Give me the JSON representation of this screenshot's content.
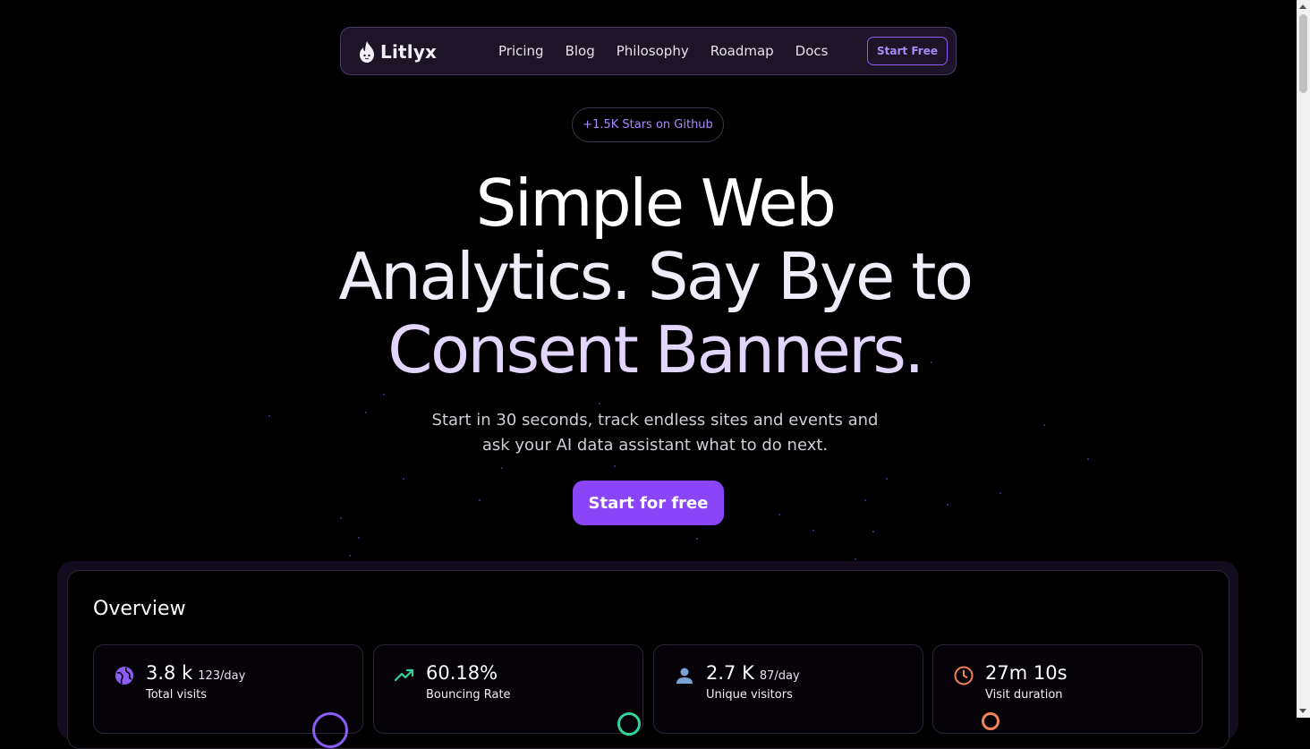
{
  "nav": {
    "brand": "Litlyx",
    "links": [
      "Pricing",
      "Blog",
      "Philosophy",
      "Roadmap",
      "Docs"
    ],
    "cta": "Start Free"
  },
  "badge": "+1.5K Stars on Github",
  "hero": {
    "line1": "Simple Web",
    "line2": "Analytics. Say Bye to",
    "line3": "Consent Banners."
  },
  "subtitle": {
    "line1": "Start in 30 seconds, track endless sites and events and",
    "line2": "ask your AI data assistant what to do next."
  },
  "cta": "Start for free",
  "overview": {
    "title": "Overview",
    "cards": [
      {
        "value": "3.8 k",
        "rate": "123/day",
        "label": "Total visits",
        "icon": "globe-icon",
        "color": "#8b5cf6"
      },
      {
        "value": "60.18%",
        "rate": "",
        "label": "Bouncing Rate",
        "icon": "trending-up-icon",
        "color": "#34d399"
      },
      {
        "value": "2.7 K",
        "rate": "87/day",
        "label": "Unique visitors",
        "icon": "user-icon",
        "color": "#7aa2d6"
      },
      {
        "value": "27m 10s",
        "rate": "",
        "label": "Visit duration",
        "icon": "clock-icon",
        "color": "#f0835a"
      }
    ]
  },
  "colors": {
    "accent": "#8b45f8",
    "background": "#000000",
    "nav_background": "#1e1428"
  }
}
